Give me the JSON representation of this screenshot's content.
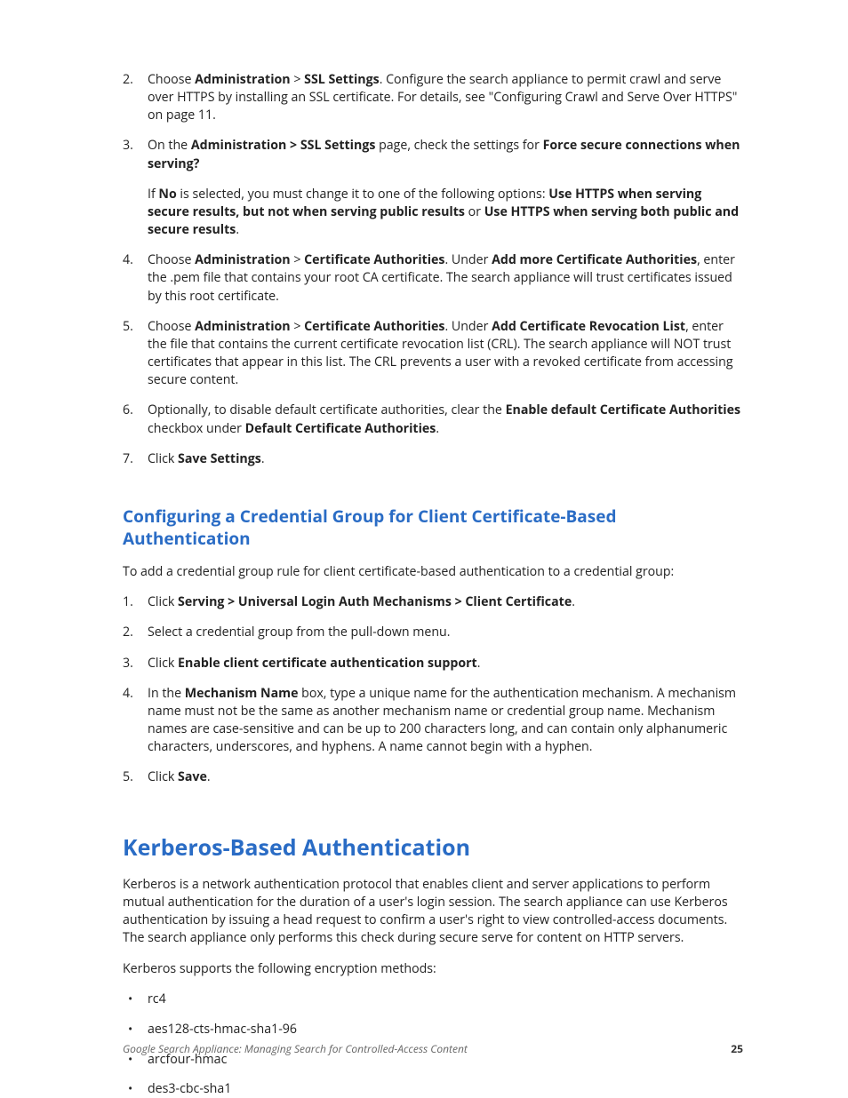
{
  "list1": {
    "i2": {
      "num": "2.",
      "pre": "Choose ",
      "b1": "Administration",
      "sep": " > ",
      "b2": "SSL Settings",
      "post": ". Configure the search appliance to permit crawl and serve over HTTPS by installing an SSL certificate. For details, see \"Configuring Crawl and Serve Over HTTPS\" on page 11."
    },
    "i3": {
      "num": "3.",
      "pre": "On the ",
      "b1": "Administration > SSL Settings",
      "mid": " page, check the settings for ",
      "b2": "Force secure connections when serving?",
      "sub_pre": "If ",
      "sub_b1": "No",
      "sub_mid1": " is selected, you must change it to one of the following options: ",
      "sub_b2": "Use HTTPS when serving secure results, but not when serving public results",
      "sub_mid2": " or ",
      "sub_b3": "Use HTTPS when serving both public and secure results",
      "sub_post": "."
    },
    "i4": {
      "num": "4.",
      "pre": "Choose ",
      "b1": "Administration",
      "sep": " > ",
      "b2": "Certificate Authorities",
      "mid1": ". Under ",
      "b3": "Add more Certificate Authorities",
      "post": ", enter the .pem file that contains your root CA certificate. The search appliance will trust certificates issued by this root certificate."
    },
    "i5": {
      "num": "5.",
      "pre": "Choose ",
      "b1": "Administration",
      "sep": " > ",
      "b2": "Certificate Authorities",
      "mid1": ". Under ",
      "b3": "Add Certificate Revocation List",
      "post": ", enter the file that contains the current certificate revocation list (CRL). The search appliance will NOT trust certificates that appear in this list. The CRL prevents a user with a revoked certificate from accessing secure content."
    },
    "i6": {
      "num": "6.",
      "pre": "Optionally, to disable default certificate authorities, clear the ",
      "b1": "Enable default Certificate Authorities",
      "mid": " checkbox under ",
      "b2": "Default Certificate Authorities",
      "post": "."
    },
    "i7": {
      "num": "7.",
      "pre": "Click ",
      "b1": "Save Settings",
      "post": "."
    }
  },
  "h2_cred": "Configuring a Credential Group for Client Certificate-Based Authentication",
  "p_cred": "To add a credential group rule for client certificate-based authentication to a credential group:",
  "list2": {
    "i1": {
      "num": "1.",
      "pre": "Click ",
      "b1": "Serving > Universal Login Auth Mechanisms > Client Certificate",
      "post": "."
    },
    "i2": {
      "num": "2.",
      "text": "Select a credential group from the pull-down menu."
    },
    "i3": {
      "num": "3.",
      "pre": "Click ",
      "b1": "Enable client certificate authentication support",
      "post": "."
    },
    "i4": {
      "num": "4.",
      "pre": "In the ",
      "b1": "Mechanism Name",
      "post": " box, type a unique name for the authentication mechanism. A mechanism name must not be the same as another mechanism name or credential group name. Mechanism names are case-sensitive and can be up to 200 characters long, and can contain only alphanumeric characters, underscores, and hyphens. A name cannot begin with a hyphen."
    },
    "i5": {
      "num": "5.",
      "pre": "Click ",
      "b1": "Save",
      "post": "."
    }
  },
  "h1_kerb": "Kerberos-Based Authentication",
  "p_kerb1": "Kerberos is a network authentication protocol that enables client and server applications to perform mutual authentication for the duration of a user's login session. The search appliance can use Kerberos authentication by issuing a head request to confirm a user's right to view controlled-access documents. The search appliance only performs this check during secure serve for content on HTTP servers.",
  "p_kerb2": "Kerberos supports the following encryption methods:",
  "bullets": {
    "b1": "rc4",
    "b2": "aes128-cts-hmac-sha1-96",
    "b3": "arcfour-hmac",
    "b4": "des3-cbc-sha1"
  },
  "footer": {
    "title": "Google Search Appliance: Managing Search for Controlled-Access Content",
    "page": "25"
  }
}
